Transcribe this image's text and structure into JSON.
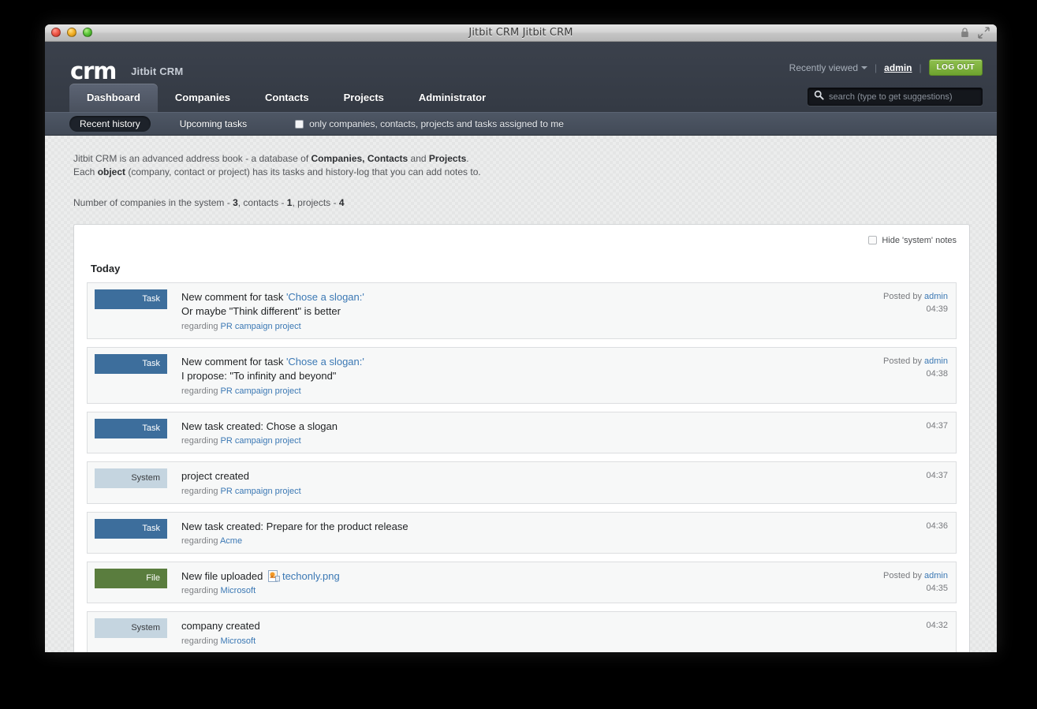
{
  "window": {
    "title": "Jitbit CRM Jitbit CRM",
    "controls": [
      "close",
      "minimize",
      "zoom"
    ],
    "right_icons": [
      "lock-icon",
      "fullscreen-icon"
    ]
  },
  "header": {
    "logo": "crm",
    "app_name": "Jitbit CRM",
    "user_bar": {
      "recently_viewed": "Recently viewed",
      "separator": "|",
      "user": "admin",
      "logout": "LOG OUT"
    },
    "search": {
      "placeholder": "search (type to get suggestions)",
      "value": "",
      "icon": "search-icon"
    },
    "tabs": [
      {
        "label": "Dashboard",
        "active": true
      },
      {
        "label": "Companies",
        "active": false
      },
      {
        "label": "Contacts",
        "active": false
      },
      {
        "label": "Projects",
        "active": false
      },
      {
        "label": "Administrator",
        "active": false
      }
    ]
  },
  "subnav": {
    "tabs": [
      {
        "label": "Recent history",
        "active": true
      },
      {
        "label": "Upcoming tasks",
        "active": false
      }
    ],
    "assigned_checkbox": {
      "label": "only companies, contacts, projects and tasks assigned to me",
      "checked": false
    }
  },
  "intro": {
    "line1_a": "Jitbit CRM is an advanced address book - a database of ",
    "line1_b": "Companies, Contacts",
    "line1_c": " and ",
    "line1_d": "Projects",
    "line1_e": ".",
    "line2_a": "Each ",
    "line2_b": "object",
    "line2_c": " (company, contact or project) has its tasks and history-log that you can add notes to.",
    "counts_a": "Number of companies in the system - ",
    "counts_companies": "3",
    "counts_b": ", contacts - ",
    "counts_contacts": "1",
    "counts_c": ", projects - ",
    "counts_projects": "4"
  },
  "panel": {
    "hide_system_notes": {
      "label": "Hide 'system' notes",
      "checked": false
    },
    "day_label": "Today",
    "regarding_prefix": "regarding ",
    "posted_by_prefix": "Posted by ",
    "entries": [
      {
        "badge": "Task",
        "badge_type": "task",
        "title_prefix": "New comment for task ",
        "title_link": "'Chose a slogan:'",
        "body": "Or maybe \"Think different\" is better",
        "regarding": "PR campaign project",
        "posted_by": "admin",
        "time": "04:39"
      },
      {
        "badge": "Task",
        "badge_type": "task",
        "title_prefix": "New comment for task ",
        "title_link": "'Chose a slogan:'",
        "body": "I propose: \"To infinity and beyond\"",
        "regarding": "PR campaign project",
        "posted_by": "admin",
        "time": "04:38"
      },
      {
        "badge": "Task",
        "badge_type": "task",
        "title_prefix": "New task created: Chose a slogan",
        "title_link": "",
        "body": "",
        "regarding": "PR campaign project",
        "posted_by": "",
        "time": "04:37"
      },
      {
        "badge": "System",
        "badge_type": "system",
        "title_prefix": "project created",
        "title_link": "",
        "body": "",
        "regarding": "PR campaign project",
        "posted_by": "",
        "time": "04:37"
      },
      {
        "badge": "Task",
        "badge_type": "task",
        "title_prefix": "New task created: Prepare for the product release",
        "title_link": "",
        "body": "",
        "regarding": "Acme",
        "posted_by": "",
        "time": "04:36"
      },
      {
        "badge": "File",
        "badge_type": "file",
        "title_prefix": "New file uploaded ",
        "title_icon": "image-file-icon",
        "title_link": "techonly.png",
        "body": "",
        "regarding": "Microsoft",
        "posted_by": "admin",
        "time": "04:35"
      },
      {
        "badge": "System",
        "badge_type": "system",
        "title_prefix": "company created",
        "title_link": "",
        "body": "",
        "regarding": "Microsoft",
        "posted_by": "",
        "time": "04:32"
      }
    ]
  },
  "colors": {
    "header_bg": "#363c46",
    "subnav_bg": "#4a525f",
    "task_badge": "#3d6e9c",
    "file_badge": "#5a7d3e",
    "system_badge": "#c5d5e0",
    "link": "#3b78b4",
    "logout_green": "#7db13c"
  }
}
